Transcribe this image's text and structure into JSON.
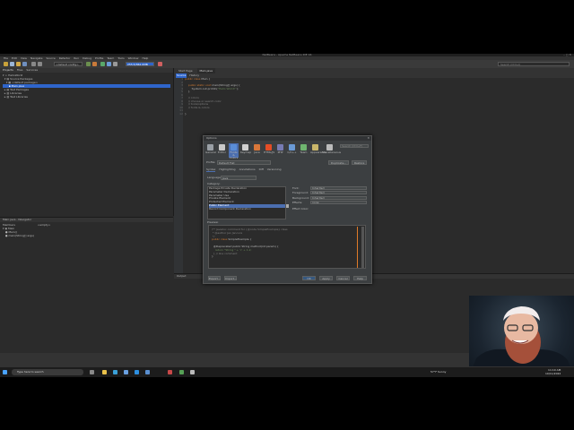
{
  "ide": {
    "title": "NetBeans - Apache NetBeans IDE 16",
    "window_controls": "– ▢ ✕",
    "menu": [
      "File",
      "Edit",
      "View",
      "Navigate",
      "Source",
      "Refactor",
      "Run",
      "Debug",
      "Profile",
      "Team",
      "Tools",
      "Window",
      "Help"
    ],
    "config_combo": "<default config>",
    "memory_label": "255.5/362.0MB",
    "search_placeholder": "Search (Ctrl+I)",
    "colors": {
      "bg": "#2b2b2b",
      "selection": "#2f65ca",
      "keyword": "#cc7832",
      "string": "#6a8759",
      "comment": "#808080"
    }
  },
  "projects": {
    "tabs": [
      "Projects",
      "Files",
      "Services"
    ],
    "tree": [
      "HelloWorld",
      "Source Packages",
      "<default package>",
      "Main.java",
      "Test Packages",
      "Libraries",
      "Test Libraries"
    ],
    "selected_index": 3
  },
  "navigator": {
    "title": "Main.java - Navigator",
    "members_label": "Members",
    "filter_placeholder": "<empty>",
    "items": [
      "Main",
      "Main()",
      "main(String[] args)"
    ]
  },
  "editor": {
    "tabs": [
      "Start Page",
      "Main.java"
    ],
    "active_tab": 1,
    "toolbar": [
      "Source",
      "History"
    ],
    "line_numbers": [
      "1",
      "2",
      "3",
      "4",
      "5",
      "6",
      "7",
      "8",
      "9",
      "10",
      "11",
      "12"
    ],
    "code": {
      "l1_kw": "public class ",
      "l1_rest": "Main {",
      "l3_kw": "public static void ",
      "l3_rest": "main(String[] args) {",
      "l4_pre": "System.out.println(",
      "l4_str": "\"Hello World!\"",
      "l4_post": ");",
      "l5": "}",
      "l7": "// colors",
      "l8": "// choose or search color",
      "l9": "// tools/options",
      "l10": "// fonts & colors",
      "l12": "}"
    }
  },
  "output": {
    "title": "Output"
  },
  "options": {
    "title": "Options",
    "close": "✕",
    "categories": [
      {
        "label": "General",
        "icon": "gear-icon",
        "color": "#9aa0a6"
      },
      {
        "label": "Editor",
        "icon": "editor-icon",
        "color": "#c9c9c9"
      },
      {
        "label": "Fonts & Colors",
        "icon": "palette-icon",
        "color": "#5a8dd6"
      },
      {
        "label": "Keymap",
        "icon": "keymap-icon",
        "color": "#d0d0d0"
      },
      {
        "label": "Java",
        "icon": "java-icon",
        "color": "#d9773a"
      },
      {
        "label": "HTML/JS",
        "icon": "html5-icon",
        "color": "#e44d26"
      },
      {
        "label": "PHP",
        "icon": "php-icon",
        "color": "#777bb3"
      },
      {
        "label": "C/C++",
        "icon": "cpp-icon",
        "color": "#6a9ad6"
      },
      {
        "label": "Team",
        "icon": "team-icon",
        "color": "#6fb56f"
      },
      {
        "label": "Appearance",
        "icon": "appearance-icon",
        "color": "#c9b66a"
      },
      {
        "label": "Miscellaneous",
        "icon": "misc-icon",
        "color": "#bbbbbb"
      }
    ],
    "active_category": 2,
    "search_placeholder": "Search (Ctrl+F)",
    "profile_label": "Profile:",
    "profile_value": "Default Flat",
    "duplicate_btn": "Duplicate...",
    "restore_btn": "Restore",
    "subtabs": [
      "Syntax",
      "Highlighting",
      "Annotations",
      "Diff",
      "Versioning"
    ],
    "active_subtab": 0,
    "language_label": "Language:",
    "language_value": "Java",
    "category_label": "Category:",
    "category_items": [
      "Package Private Declaration",
      "Parameter Declaration",
      "Parameter Use",
      "Private Element",
      "Protected Element",
      "Public Element",
      "Record Component Declaration"
    ],
    "category_selected": 5,
    "props": [
      {
        "label": "Font:",
        "value": "Inherited"
      },
      {
        "label": "Foreground:",
        "value": "Inherited"
      },
      {
        "label": "Background:",
        "value": "Inherited"
      },
      {
        "label": "Effects:",
        "value": "none"
      },
      {
        "label": "Effect Color:",
        "value": ""
      }
    ],
    "preview_label": "Preview:",
    "preview": {
      "c1": "/** Javadoc comment for {@code SimpleExample} class",
      "c2": " * @author Jan Jancura",
      "c3": " */",
      "l4_kw": "public class ",
      "l4_rest": "SimpleExample {",
      "l6": "  @Deprecated public String method(int param) {",
      "l7": "    return \"String \" + 'c' + 1.2;",
      "l8": "  } // line comment",
      "l9": "}"
    },
    "buttons": [
      "Export...",
      "Import...",
      "OK",
      "Apply",
      "Cancel",
      "Help"
    ]
  },
  "taskbar": {
    "search": "Type here to search",
    "icons": [
      "windows-icon",
      "taskview-icon",
      "explorer-icon",
      "edge-icon",
      "store-icon",
      "vscode-icon",
      "mail-icon",
      "netbeans-icon",
      "notepad-icon",
      "terminal-icon"
    ],
    "weather": "57°F Sunny",
    "time": "11:10 AM",
    "date": "10/11/2022"
  }
}
